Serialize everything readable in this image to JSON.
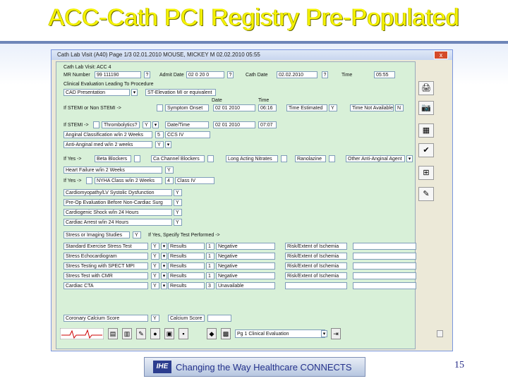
{
  "slide": {
    "title": "ACC-Cath PCI Registry Pre-Populated",
    "banner_logo": "IHE",
    "banner_text": "Changing the Way Healthcare CONNECTS",
    "page_number": "15"
  },
  "window": {
    "title": "Cath Lab Visit (A40) Page 1/3     02.01.2010    MOUSE, MICKEY M    02.02.2010    05:55",
    "close_symbol": "x"
  },
  "form": {
    "visit_header": "Cath Lab Visit: ACC 4",
    "mr_label": "MR Number",
    "mr_value": "99 111190",
    "admit_label": "Admit Date",
    "admit_value": "02 0  20  0",
    "cath_label": "Cath Date",
    "cath_value": "02.02.2010",
    "time_label": "Time",
    "time_value": "05:55",
    "section_clinical": "Clinical Evaluation Leading To Procedure",
    "cad_label": "CAD Presentation",
    "cad_value": "ST-Elevation MI or equivalent",
    "date_col": "Date",
    "time_col": "Time",
    "stemi_label": "If STEMI or Non STEMI ->",
    "symptom_onset": "Symptom Onset",
    "symptom_date": "02 01 2010",
    "symptom_time": "06:16",
    "time_estimated": "Time Estimated",
    "time_estimated_val": "Y",
    "time_not_avail": "Time Not Available",
    "time_not_avail_val": "N",
    "stemi2_label": "If STEMI ->",
    "thrombolytics": "Thrombolytics?",
    "thrombolytics_val": "Y",
    "datetime_label": "Date/Time",
    "datetime_date": "02 01 2010",
    "datetime_time": "07:07",
    "angina_class": "Anginal Classification w/in 2 Weeks",
    "angina_class_num": "5",
    "angina_class_val": "CCS IV",
    "anti_anginal": "Anti-Anginal med w/in 2 weeks",
    "anti_anginal_val": "Y",
    "ifyes_label": "If Yes ->",
    "beta_blockers": "Beta Blockers",
    "ca_blockers": "Ca Channel Blockers",
    "long_nitrates": "Long Acting Nitrates",
    "ranolazine": "Ranolazine",
    "other_agent": "Other Anti-Anginal Agent",
    "heart_failure": "Heart Failure w/in 2 Weeks",
    "heart_failure_val": "Y",
    "ifyes2_label": "If Yes ->",
    "nyha": "NYHA Class w/in 2 Weeks",
    "nyha_num": "4",
    "nyha_val": "Class IV",
    "cardiomyopathy": "Cardiomyopathy/LV Systolic Dysfunction",
    "cardiomyopathy_val": "Y",
    "preop": "Pre-Op Evaluation Before Non-Cardiac Surg",
    "preop_val": "Y",
    "cardiogenic": "Cardiogenic Shock w/in 24 Hours",
    "cardiogenic_val": "Y",
    "arrest": "Cardiac Arrest w/in 24 Hours",
    "arrest_val": "Y",
    "stress": "Stress or Imaging Studies",
    "stress_val": "Y",
    "specify_label": "If Yes, Specify Test Performed ->",
    "tests": [
      {
        "name": "Standard Exercise Stress Test",
        "flag": "Y",
        "results": "Results",
        "num": "1",
        "outcome": "Negative",
        "risk": "Risk/Extent of Ischemia"
      },
      {
        "name": "Stress Echocardiogram",
        "flag": "Y",
        "results": "Results",
        "num": "1",
        "outcome": "Negative",
        "risk": "Risk/Extent of Ischemia"
      },
      {
        "name": "Stress Testing with SPECT MPI",
        "flag": "Y",
        "results": "Results",
        "num": "1",
        "outcome": "Negative",
        "risk": "Risk/Extent of Ischemia"
      },
      {
        "name": "Stress Test with CMR",
        "flag": "Y",
        "results": "Results",
        "num": "1",
        "outcome": "Negative",
        "risk": "Risk/Extent of Ischemia"
      },
      {
        "name": "Cardiac CTA",
        "flag": "Y",
        "results": "Results",
        "num": "3",
        "outcome": "Unavailable",
        "risk": ""
      }
    ],
    "calcium": "Coronary Calcium Score",
    "calcium_val": "Y",
    "calcium_score_label": "Calcium Score",
    "page_select": "Pg 1 Clinical Evaluation"
  }
}
